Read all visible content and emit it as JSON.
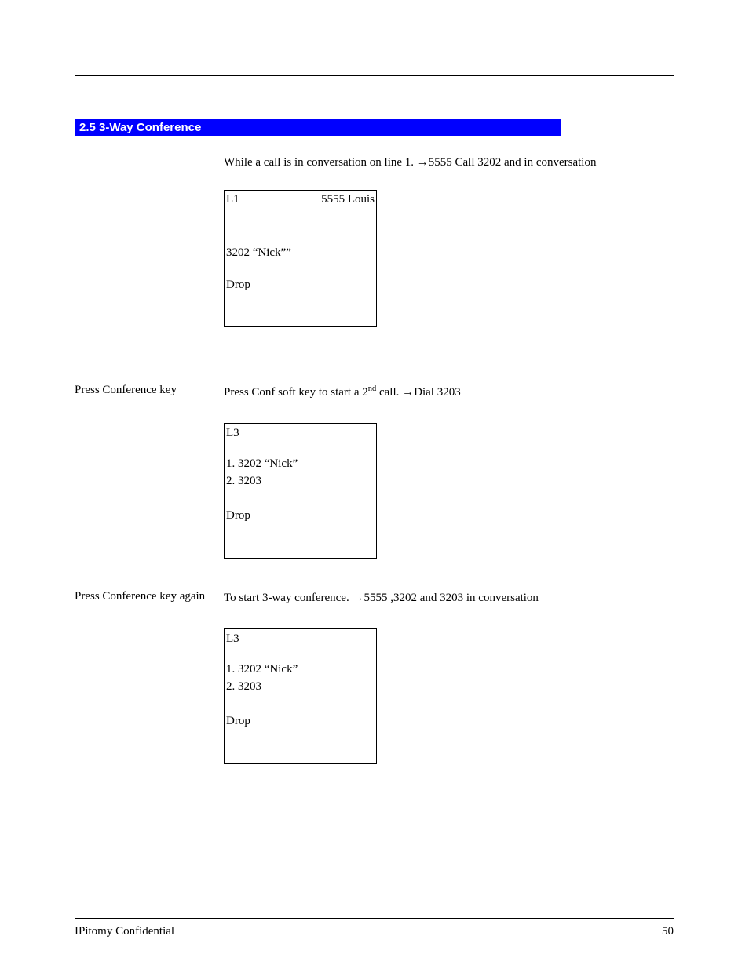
{
  "section_heading": "2.5 3-Way Conference",
  "step1": {
    "left": "",
    "text_before": "While a call is in conversation on line 1. ",
    "arrow": "→",
    "text_after": "5555 Call 3202 and in conversation",
    "display": {
      "line_label": "L1",
      "header_right": "5555  Louis",
      "mid_line": "3202  “Nick””",
      "softkey": "Drop"
    }
  },
  "step2": {
    "left": "Press Conference key",
    "text_before": "Press Conf soft key to start a 2",
    "sup": "nd",
    "text_mid": " call. ",
    "arrow": "→",
    "text_after": "Dial 3203",
    "display": {
      "line_label": "L3",
      "row1": "1. 3202 “Nick”",
      "row2": "2. 3203",
      "softkey": "Drop"
    }
  },
  "step3": {
    "left": "Press Conference key again",
    "text_before": "To start 3-way conference. ",
    "arrow": "→",
    "text_after": "5555 ,3202 and 3203 in conversation",
    "display": {
      "line_label": "L3",
      "row1": "1. 3202 “Nick”",
      "row2": "2. 3203",
      "softkey": "Drop"
    }
  },
  "footer": {
    "left": "IPitomy Confidential",
    "right": "50"
  }
}
